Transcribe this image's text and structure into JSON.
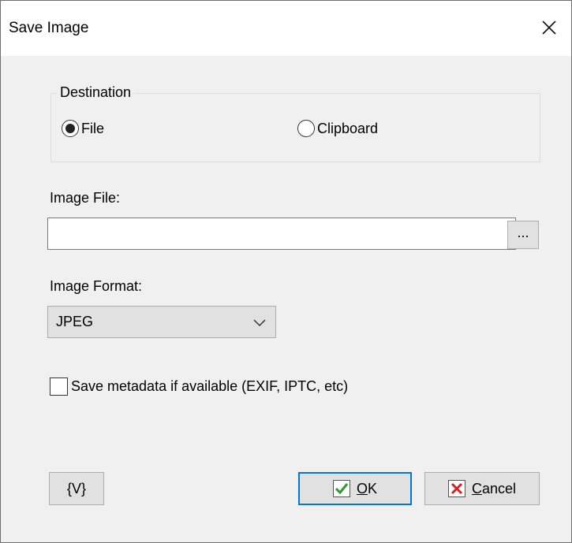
{
  "window": {
    "title": "Save Image"
  },
  "destination": {
    "legend": "Destination",
    "options": [
      {
        "label": "File",
        "selected": true
      },
      {
        "label": "Clipboard",
        "selected": false
      }
    ]
  },
  "image_file": {
    "label": "Image File:",
    "value": "",
    "browse_label": "..."
  },
  "image_format": {
    "label": "Image Format:",
    "selected": "JPEG"
  },
  "metadata": {
    "label": "Save metadata if available (EXIF, IPTC, etc)",
    "checked": false
  },
  "buttons": {
    "variables_label": "{V}",
    "ok_mnemonic": "O",
    "ok_rest": "K",
    "cancel_mnemonic": "C",
    "cancel_rest": "ancel"
  },
  "icons": {
    "ok": "checkmark-icon",
    "cancel": "x-icon",
    "close": "close-icon"
  },
  "colors": {
    "ok_check": "#2e9b2e",
    "cancel_x": "#d42020",
    "focus_border": "#0078d7"
  }
}
